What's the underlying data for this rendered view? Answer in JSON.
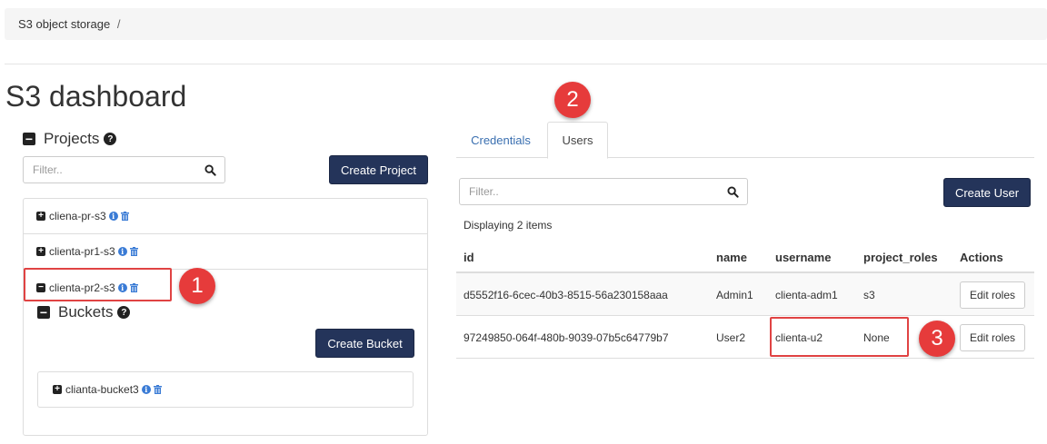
{
  "breadcrumb": {
    "item": "S3 object storage",
    "separator": "/"
  },
  "page": {
    "title": "S3 dashboard"
  },
  "projects": {
    "heading": "Projects",
    "filter_placeholder": "Filter..",
    "create_label": "Create Project",
    "items": [
      {
        "name": "cliena-pr-s3",
        "expanded": false
      },
      {
        "name": "clienta-pr1-s3",
        "expanded": false
      },
      {
        "name": "clienta-pr2-s3",
        "expanded": true
      }
    ]
  },
  "buckets": {
    "heading": "Buckets",
    "create_label": "Create Bucket",
    "items": [
      {
        "name": "clianta-bucket3"
      }
    ]
  },
  "tabs": [
    {
      "label": "Credentials",
      "active": false
    },
    {
      "label": "Users",
      "active": true
    }
  ],
  "users": {
    "filter_placeholder": "Filter..",
    "create_label": "Create User",
    "display_count": "Displaying 2 items",
    "columns": [
      "id",
      "name",
      "username",
      "project_roles",
      "Actions"
    ],
    "rows": [
      {
        "id": "d5552f16-6cec-40b3-8515-56a230158aaa",
        "name": "Admin1",
        "username": "clienta-adm1",
        "project_roles": "s3",
        "action": "Edit roles"
      },
      {
        "id": "97249850-064f-480b-9039-07b5c64779b7",
        "name": "User2",
        "username": "clienta-u2",
        "project_roles": "None",
        "action": "Edit roles"
      }
    ]
  },
  "annotations": {
    "marker_1": "1",
    "marker_2": "2",
    "marker_3": "3"
  },
  "colors": {
    "primary_button": "#24345a",
    "link": "#3a6fb0",
    "info_icon": "#3a7bd5",
    "highlight": "#e04343"
  },
  "icons": {
    "expand": "plus-square-icon",
    "collapse": "minus-square-icon",
    "info": "info-circle-icon",
    "delete": "trash-icon",
    "help": "question-circle-icon",
    "search": "search-icon"
  }
}
